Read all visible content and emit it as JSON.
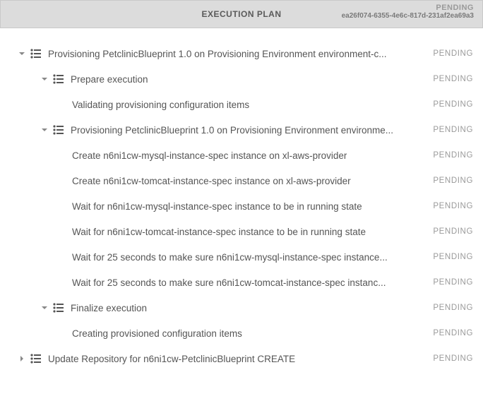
{
  "header": {
    "title": "EXECUTION PLAN",
    "status": "PENDING",
    "id": "ea26f074-6355-4e6c-817d-231af2ea69a3"
  },
  "pending": "PENDING",
  "rows": [
    {
      "label": "Provisioning PetclinicBlueprint 1.0 on Provisioning Environment environment-c..."
    },
    {
      "label": "Prepare execution"
    },
    {
      "label": "Validating provisioning configuration items"
    },
    {
      "label": "Provisioning PetclinicBlueprint 1.0 on Provisioning Environment environme..."
    },
    {
      "label": "Create n6ni1cw-mysql-instance-spec instance on xl-aws-provider"
    },
    {
      "label": "Create n6ni1cw-tomcat-instance-spec instance on xl-aws-provider"
    },
    {
      "label": "Wait for n6ni1cw-mysql-instance-spec instance to be in running state"
    },
    {
      "label": "Wait for n6ni1cw-tomcat-instance-spec instance to be in running state"
    },
    {
      "label": "Wait for 25 seconds to make sure n6ni1cw-mysql-instance-spec instance..."
    },
    {
      "label": "Wait for 25 seconds to make sure n6ni1cw-tomcat-instance-spec instanc..."
    },
    {
      "label": "Finalize execution"
    },
    {
      "label": "Creating provisioned configuration items"
    },
    {
      "label": "Update Repository for n6ni1cw-PetclinicBlueprint CREATE"
    }
  ]
}
